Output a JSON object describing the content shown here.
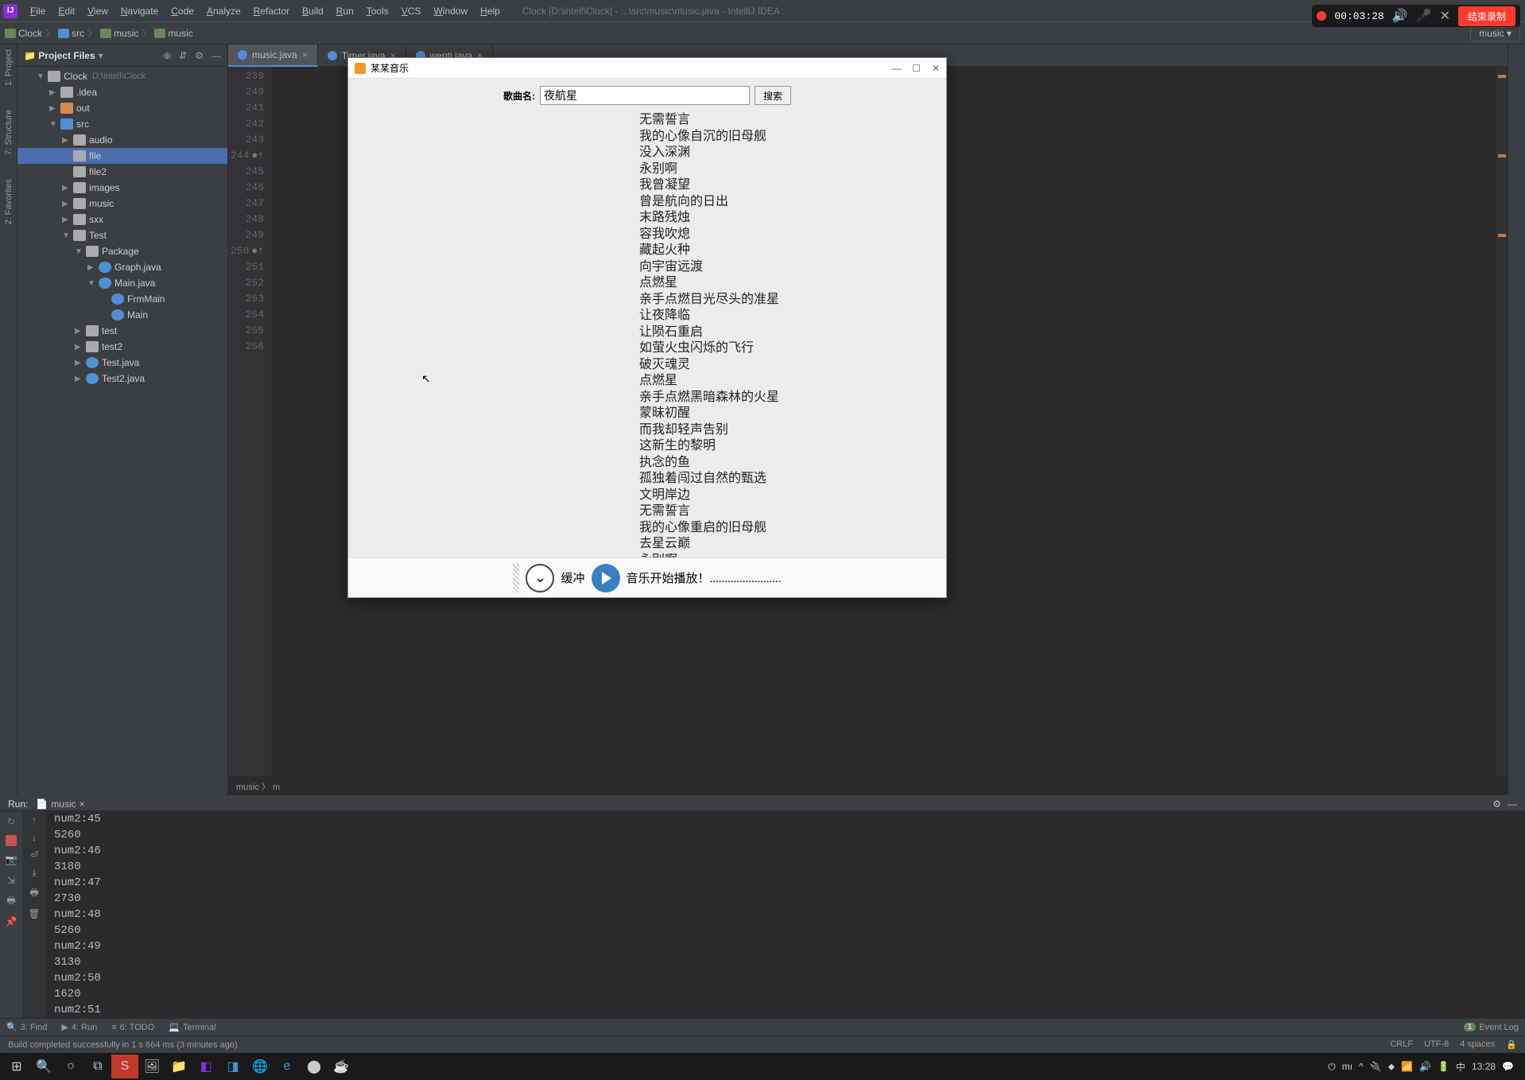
{
  "menu": {
    "items": [
      "File",
      "Edit",
      "View",
      "Navigate",
      "Code",
      "Analyze",
      "Refactor",
      "Build",
      "Run",
      "Tools",
      "VCS",
      "Window",
      "Help"
    ],
    "title_path": "Clock [D:\\intell\\Clock] - ...\\src\\music\\music.java - IntelliJ IDEA"
  },
  "recording": {
    "time": "00:03:28",
    "end_label": "结束录制"
  },
  "breadcrumb": {
    "items": [
      "Clock",
      "src",
      "music",
      "music"
    ],
    "run_config": "music"
  },
  "project_panel": {
    "title": "Project Files",
    "root_name": "Clock",
    "root_hint": "D:\\intell\\Clock",
    "tree": [
      {
        "d": 1,
        "t": "arrow",
        "a": "▼",
        "i": "folder",
        "l": "Clock",
        "hint": "D:\\intell\\Clock"
      },
      {
        "d": 2,
        "t": "arrow",
        "a": "▶",
        "i": "folder",
        "l": ".idea"
      },
      {
        "d": 2,
        "t": "arrow",
        "a": "▶",
        "i": "orange",
        "l": "out"
      },
      {
        "d": 2,
        "t": "arrow",
        "a": "▼",
        "i": "folder-blue",
        "l": "src"
      },
      {
        "d": 3,
        "t": "arrow",
        "a": "▶",
        "i": "folder",
        "l": "audio"
      },
      {
        "d": 3,
        "t": "none",
        "a": "",
        "i": "folder",
        "l": "file",
        "sel": true
      },
      {
        "d": 3,
        "t": "none",
        "a": "",
        "i": "folder",
        "l": "file2"
      },
      {
        "d": 3,
        "t": "arrow",
        "a": "▶",
        "i": "folder",
        "l": "images"
      },
      {
        "d": 3,
        "t": "arrow",
        "a": "▶",
        "i": "folder",
        "l": "music"
      },
      {
        "d": 3,
        "t": "arrow",
        "a": "▶",
        "i": "folder",
        "l": "sxx"
      },
      {
        "d": 3,
        "t": "arrow",
        "a": "▼",
        "i": "folder",
        "l": "Test"
      },
      {
        "d": 4,
        "t": "arrow",
        "a": "▼",
        "i": "folder",
        "l": "Package"
      },
      {
        "d": 5,
        "t": "arrow",
        "a": "▶",
        "i": "java",
        "l": "Graph.java"
      },
      {
        "d": 5,
        "t": "arrow",
        "a": "▼",
        "i": "java",
        "l": "Main.java"
      },
      {
        "d": 6,
        "t": "none",
        "a": "",
        "i": "java",
        "l": "FrmMain"
      },
      {
        "d": 6,
        "t": "none",
        "a": "",
        "i": "java",
        "l": "Main"
      },
      {
        "d": 4,
        "t": "arrow",
        "a": "▶",
        "i": "folder",
        "l": "test"
      },
      {
        "d": 4,
        "t": "arrow",
        "a": "▶",
        "i": "folder",
        "l": "test2"
      },
      {
        "d": 4,
        "t": "arrow",
        "a": "▶",
        "i": "java",
        "l": "Test.java"
      },
      {
        "d": 4,
        "t": "arrow",
        "a": "▶",
        "i": "java",
        "l": "Test2.java"
      }
    ]
  },
  "editor": {
    "tabs": [
      {
        "label": "music.java",
        "active": true
      },
      {
        "label": "Timer.java"
      },
      {
        "label": "wenti.java"
      }
    ],
    "line_start": 239,
    "line_end": 256,
    "marked_lines": [
      244,
      250
    ],
    "crumb": "music  〉  m"
  },
  "run": {
    "label": "Run:",
    "config": "music",
    "console_lines": [
      "num2:45",
      "5260",
      "num2:46",
      "3180",
      "num2:47",
      "2730",
      "num2:48",
      "5260",
      "num2:49",
      "3130",
      "num2:50",
      "1620",
      "num2:51"
    ]
  },
  "bottom_toolbar": {
    "find": "3: Find",
    "run": "4: Run",
    "todo": "6: TODO",
    "terminal": "Terminal",
    "event_log": "Event Log",
    "badge": "1"
  },
  "status": {
    "msg": "Build completed successfully in 1 s 664 ms (3 minutes ago)",
    "crlf": "CRLF",
    "enc": "UTF-8",
    "indent": "4 spaces"
  },
  "taskbar": {
    "time": "13:28",
    "ime": "中"
  },
  "modal": {
    "title": "某某音乐",
    "search_label": "歌曲名:",
    "search_value": "夜航星",
    "search_btn": "搜索",
    "lyrics": [
      "无需誓言",
      "我的心像自沉的旧母舰",
      "没入深渊",
      "永别啊",
      "我曾凝望",
      "曾是航向的日出",
      "末路残烛",
      "容我吹熄",
      "藏起火种",
      "向宇宙远渡",
      "点燃星",
      "亲手点燃目光尽头的准星",
      "让夜降临",
      "让陨石重启",
      "如萤火虫闪烁的飞行",
      "破灭魂灵",
      "点燃星",
      "亲手点燃黑暗森林的火星",
      "蒙昧初醒",
      "而我却轻声告别",
      "这新生的黎明",
      "执念的鱼",
      "孤独着闯过自然的甄选",
      "文明岸边",
      "无需誓言",
      "我的心像重启的旧母舰",
      "去星云巅",
      "永别啊"
    ],
    "buffer_label": "缓冲",
    "status_text": "音乐开始播放！........................"
  }
}
